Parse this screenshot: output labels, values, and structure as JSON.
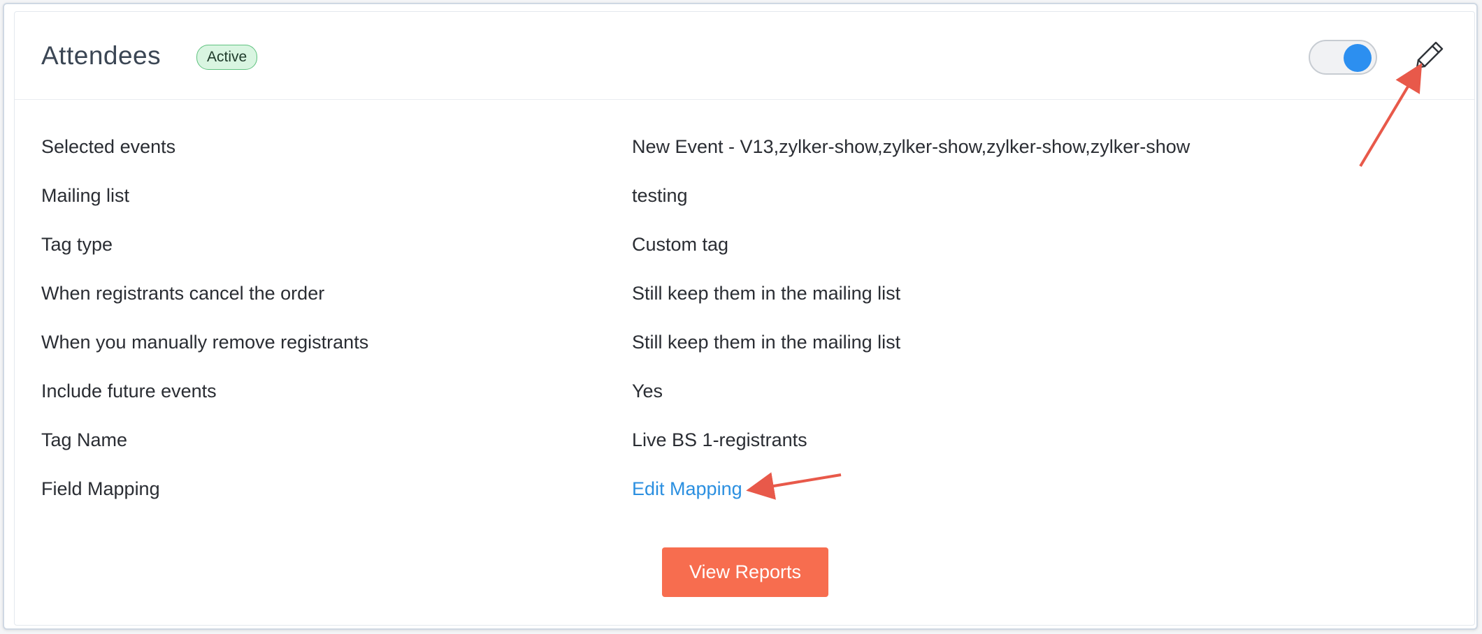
{
  "header": {
    "title": "Attendees",
    "status_badge": "Active",
    "toggle": {
      "state": "on",
      "color": "#2c8ff0"
    },
    "edit_icon": "pencil-icon"
  },
  "details": [
    {
      "label": "Selected events",
      "value": "New Event - V13,zylker-show,zylker-show,zylker-show,zylker-show"
    },
    {
      "label": "Mailing list",
      "value": "testing"
    },
    {
      "label": "Tag type",
      "value": "Custom tag"
    },
    {
      "label": "When registrants cancel the order",
      "value": "Still keep them in the mailing list"
    },
    {
      "label": "When you manually remove registrants",
      "value": "Still keep them in the mailing list"
    },
    {
      "label": "Include future events",
      "value": "Yes"
    },
    {
      "label": "Tag Name",
      "value": "Live BS 1-registrants"
    },
    {
      "label": "Field Mapping",
      "value": "Edit Mapping"
    }
  ],
  "actions": {
    "view_reports_label": "View Reports"
  },
  "colors": {
    "accent_link": "#2b8fe0",
    "button_primary": "#f76d4f",
    "badge_bg": "#d9f5e1",
    "annotation_arrow": "#e8594a"
  }
}
